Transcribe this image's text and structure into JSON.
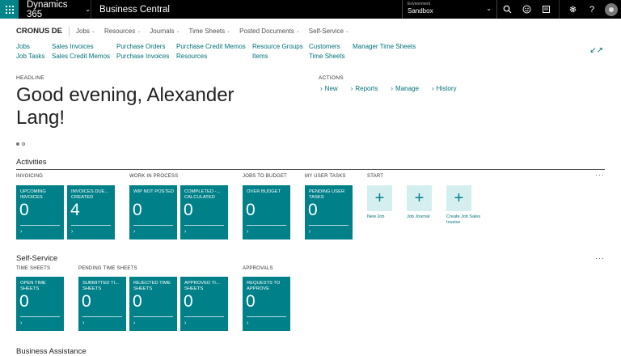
{
  "topbar": {
    "app_name": "Dynamics 365",
    "product": "Business Central",
    "environment_label": "Environment",
    "environment_value": "Sandbox"
  },
  "nav": {
    "company": "CRONUS DE",
    "items": [
      "Jobs",
      "Resources",
      "Journals",
      "Time Sheets",
      "Posted Documents",
      "Self-Service"
    ]
  },
  "links": {
    "col1": [
      "Jobs",
      "Job Tasks"
    ],
    "col2": [
      "Sales Invoices",
      "Sales Credit Memos"
    ],
    "col3": [
      "Purchase Orders",
      "Purchase Invoices"
    ],
    "col4": [
      "Purchase Credit Memos",
      "Resources"
    ],
    "col5": [
      "Resource Groups",
      "Items"
    ],
    "col6": [
      "Customers",
      "Time Sheets"
    ],
    "col7": [
      "Manager Time Sheets"
    ]
  },
  "headline": {
    "label": "HEADLINE",
    "text": "Good evening, Alexander Lang!"
  },
  "actions": {
    "label": "ACTIONS",
    "items": [
      "New",
      "Reports",
      "Manage",
      "History"
    ]
  },
  "activities": {
    "title": "Activities",
    "groups": {
      "invoicing": "INVOICING",
      "wip": "WORK IN PROCESS",
      "budget": "JOBS TO BUDGET",
      "tasks": "MY USER TASKS",
      "start": "START"
    },
    "tiles": [
      {
        "label": "UPCOMING INVOICES",
        "value": "0"
      },
      {
        "label": "INVOICES DUE... CREATED",
        "value": "4"
      },
      {
        "label": "WIP NOT POSTED",
        "value": "0"
      },
      {
        "label": "COMPLETED -... CALCULATED",
        "value": "0"
      },
      {
        "label": "OVER BUDGET",
        "value": "0"
      },
      {
        "label": "PENDING USER TASKS",
        "value": "0"
      }
    ],
    "start_items": [
      "New Job",
      "Job Journal",
      "Create Job Sales Invoice"
    ]
  },
  "self_service": {
    "title": "Self-Service",
    "groups": {
      "time": "TIME SHEETS",
      "pending": "PENDING TIME SHEETS",
      "approvals": "APPROVALS"
    },
    "tiles": [
      {
        "label": "OPEN TIME SHEETS",
        "value": "0"
      },
      {
        "label": "SUBMITTED TI... SHEETS",
        "value": "0"
      },
      {
        "label": "REJECTED TIME SHEETS",
        "value": "0"
      },
      {
        "label": "APPROVED TI... SHEETS",
        "value": "0"
      },
      {
        "label": "REQUESTS TO APPROVE",
        "value": "0"
      }
    ]
  },
  "business_assistance": {
    "title": "Business Assistance"
  },
  "colors": {
    "tile": "#00818a",
    "link": "#00707a",
    "start_tile": "#d5eef0"
  }
}
